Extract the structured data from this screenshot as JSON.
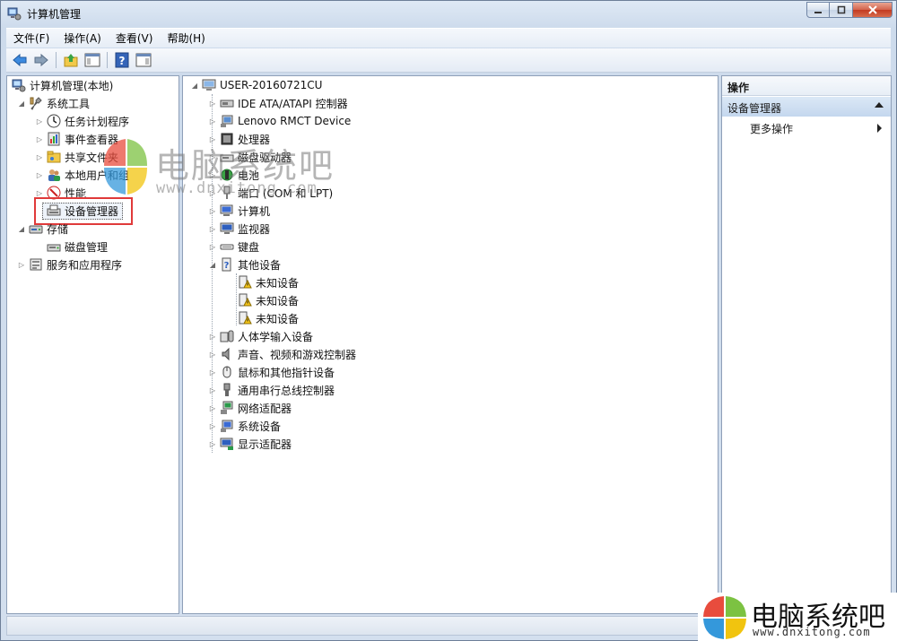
{
  "window": {
    "title": "计算机管理"
  },
  "menu": [
    "文件(F)",
    "操作(A)",
    "查看(V)",
    "帮助(H)"
  ],
  "left_tree": [
    {
      "label": "计算机管理(本地)",
      "icon": "computer-management-icon",
      "twisty": ""
    },
    {
      "label": "系统工具",
      "icon": "system-tools-icon",
      "twisty": "expanded"
    },
    {
      "label": "任务计划程序",
      "icon": "clock-icon",
      "twisty": "collapsed"
    },
    {
      "label": "事件查看器",
      "icon": "event-viewer-icon",
      "twisty": "collapsed"
    },
    {
      "label": "共享文件夹",
      "icon": "shared-folder-icon",
      "twisty": "collapsed"
    },
    {
      "label": "本地用户和组",
      "icon": "users-icon",
      "twisty": "collapsed"
    },
    {
      "label": "性能",
      "icon": "performance-icon",
      "twisty": "collapsed"
    },
    {
      "label": "设备管理器",
      "icon": "device-manager-icon",
      "twisty": ""
    },
    {
      "label": "存储",
      "icon": "storage-icon",
      "twisty": "expanded"
    },
    {
      "label": "磁盘管理",
      "icon": "disk-management-icon",
      "twisty": ""
    },
    {
      "label": "服务和应用程序",
      "icon": "services-icon",
      "twisty": "collapsed"
    }
  ],
  "device_tree": {
    "root": "USER-20160721CU",
    "items": [
      "IDE ATA/ATAPI 控制器",
      "Lenovo RMCT Device",
      "处理器",
      "磁盘驱动器",
      "电池",
      "端口 (COM 和 LPT)",
      "计算机",
      "监视器",
      "键盘",
      "其他设备",
      "未知设备",
      "未知设备",
      "未知设备",
      "人体学输入设备",
      "声音、视频和游戏控制器",
      "鼠标和其他指针设备",
      "通用串行总线控制器",
      "网络适配器",
      "系统设备",
      "显示适配器"
    ]
  },
  "actions": {
    "title": "操作",
    "section": "设备管理器",
    "more": "更多操作"
  },
  "watermark": {
    "text": "电脑系统吧",
    "url": "www.dnxitong.com"
  },
  "brand": {
    "text": "电脑系统吧",
    "url": "www.dnxitong.com"
  },
  "colors": {
    "highlight_box": "#e03a3a",
    "actions_header": "#c4d7ee"
  }
}
